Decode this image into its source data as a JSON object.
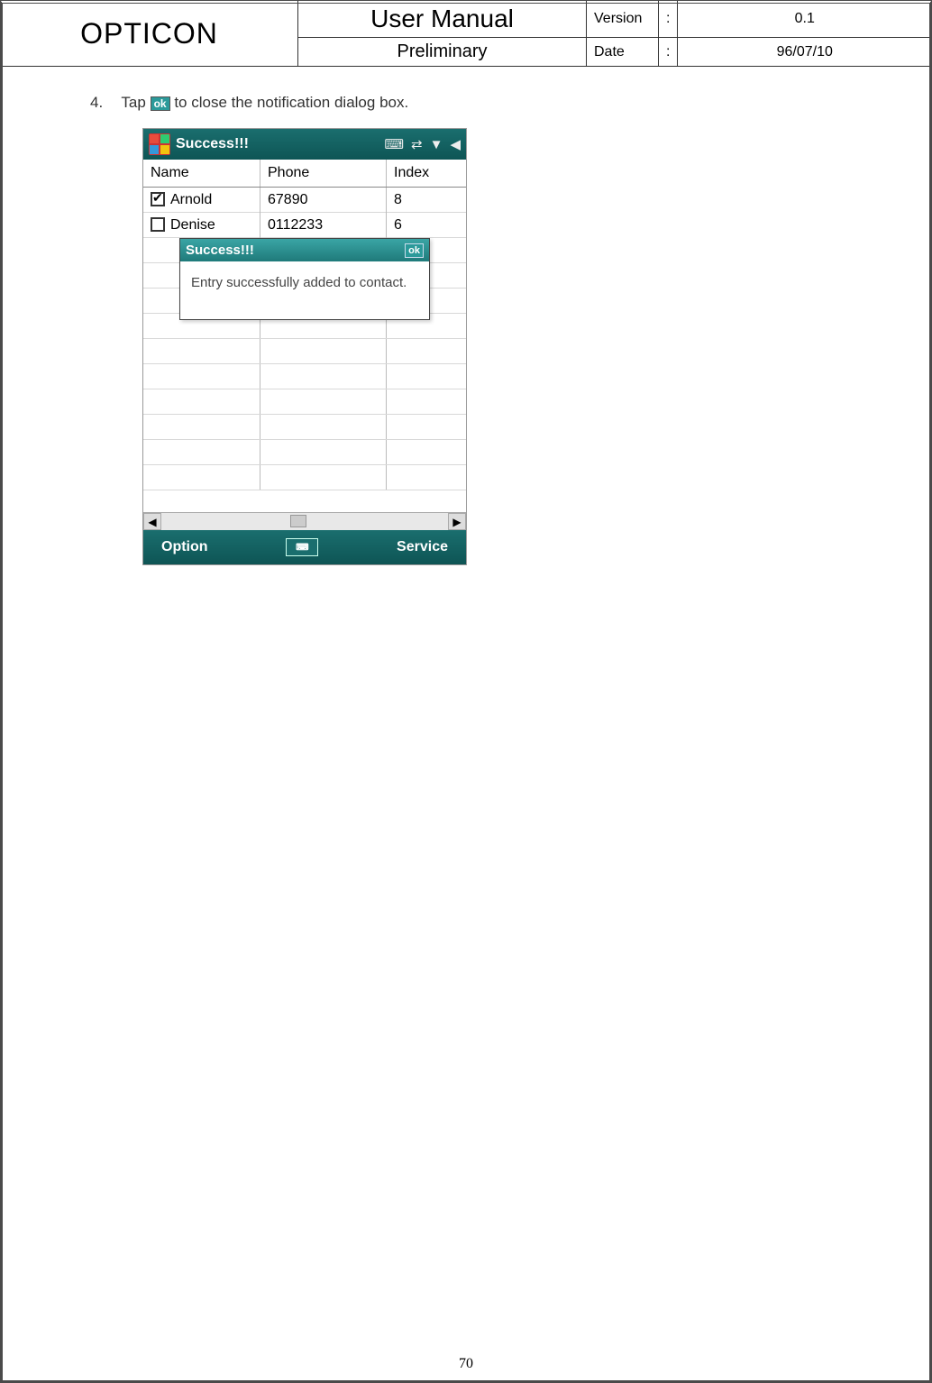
{
  "header": {
    "brand": "OPTICON",
    "title": "User Manual",
    "subtitle": "Preliminary",
    "version_label": "Version",
    "version_value": "0.1",
    "date_label": "Date",
    "date_value": "96/07/10"
  },
  "step": {
    "number": "4.",
    "text_before": "Tap ",
    "ok_label": "ok",
    "text_after": " to close the notification dialog box."
  },
  "screenshot": {
    "title": "Success!!!",
    "columns": {
      "name": "Name",
      "phone": "Phone",
      "index": "Index"
    },
    "rows": [
      {
        "checked": true,
        "name": "Arnold",
        "phone": "67890",
        "index": "8"
      },
      {
        "checked": false,
        "name": "Denise",
        "phone": "0112233",
        "index": "6"
      }
    ],
    "dialog": {
      "title": "Success!!!",
      "ok": "ok",
      "message": "Entry successfully added to contact."
    },
    "softkeys": {
      "left": "Option",
      "right": "Service"
    }
  },
  "page_number": "70"
}
